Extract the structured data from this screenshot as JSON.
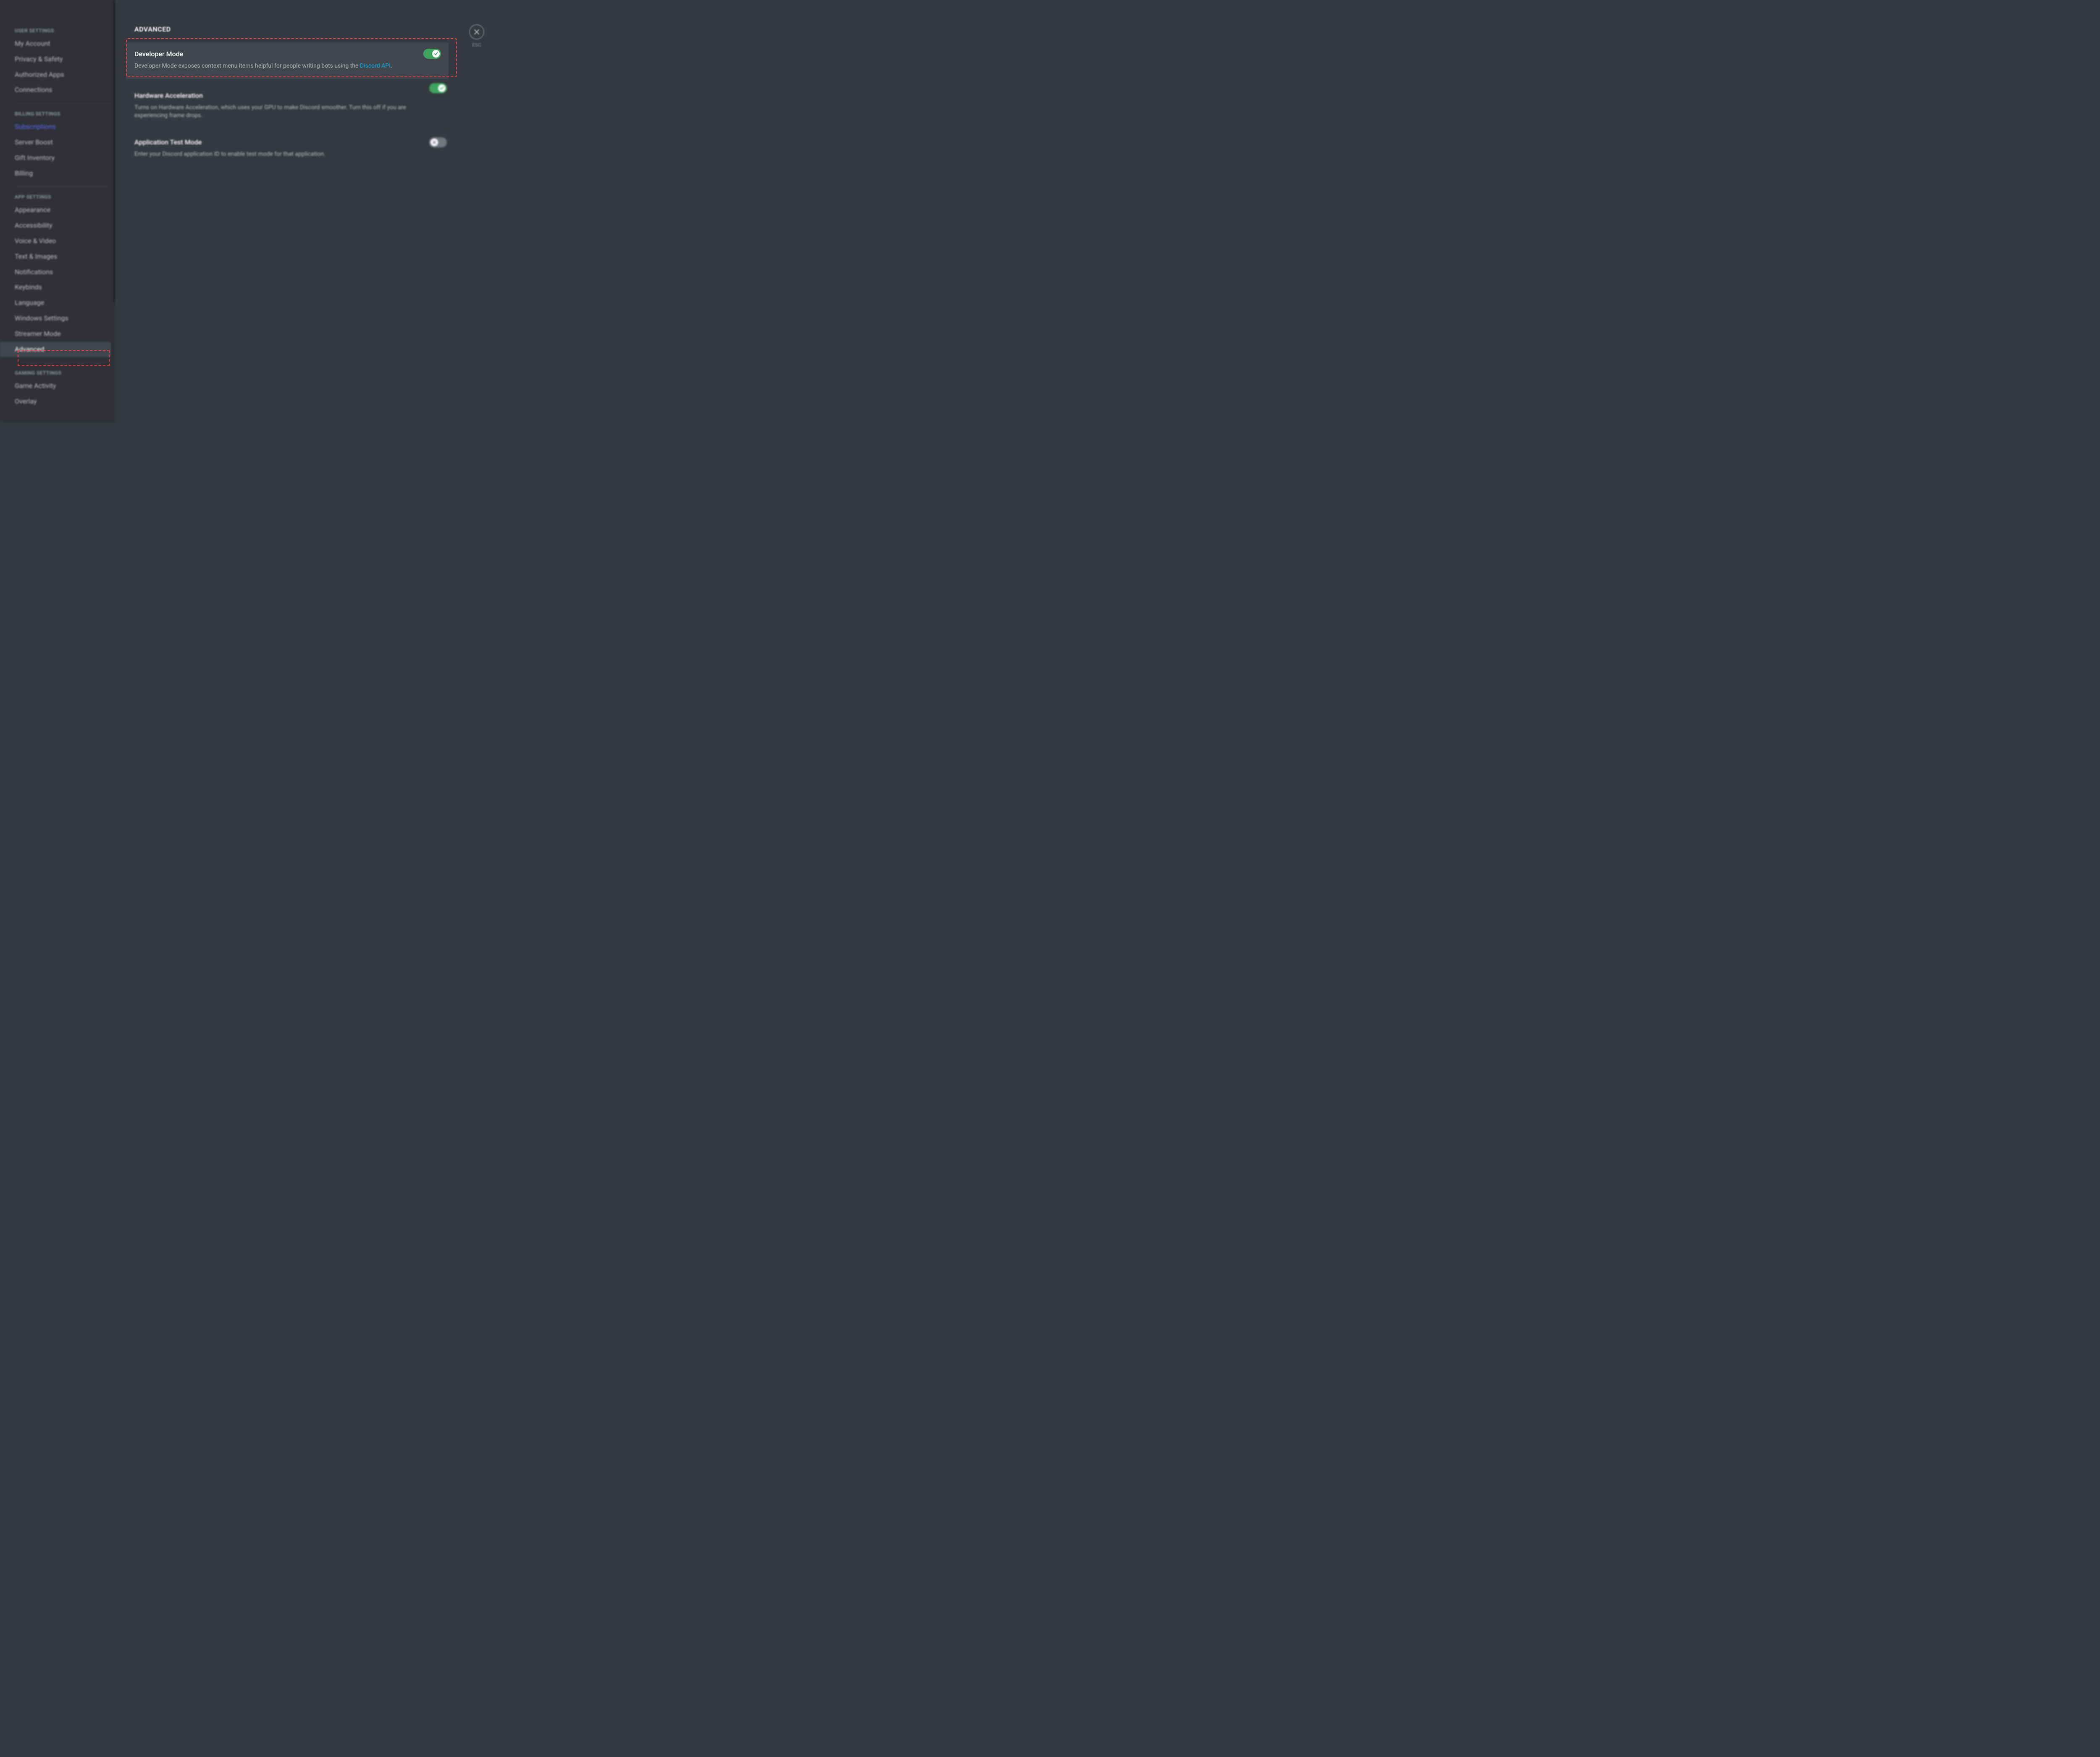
{
  "sidebar": {
    "sections": [
      {
        "header": "USER SETTINGS",
        "items": [
          "My Account",
          "Privacy & Safety",
          "Authorized Apps",
          "Connections"
        ]
      },
      {
        "header": "BILLING SETTINGS",
        "items": [
          "Subscriptions",
          "Server Boost",
          "Gift Inventory",
          "Billing"
        ]
      },
      {
        "header": "APP SETTINGS",
        "items": [
          "Appearance",
          "Accessibility",
          "Voice & Video",
          "Text & Images",
          "Notifications",
          "Keybinds",
          "Language",
          "Windows Settings",
          "Streamer Mode",
          "Advanced"
        ]
      },
      {
        "header": "GAMING SETTINGS",
        "items": [
          "Game Activity",
          "Overlay"
        ]
      }
    ],
    "selected": "Advanced",
    "blueItem": "Subscriptions"
  },
  "page": {
    "title": "ADVANCED",
    "close_label": "ESC"
  },
  "settings": {
    "devmode": {
      "title": "Developer Mode",
      "desc_pre": "Developer Mode exposes context menu items helpful for people writing bots using the ",
      "desc_link": "Discord API",
      "desc_post": ".",
      "state": "on"
    },
    "hardware": {
      "title": "Hardware Acceleration",
      "desc": "Turns on Hardware Acceleration, which uses your GPU to make Discord smoother. Turn this off if you are experiencing frame drops.",
      "state": "on"
    },
    "testmode": {
      "title": "Application Test Mode",
      "desc": "Enter your Discord application ID to enable test mode for that application.",
      "state": "off"
    }
  }
}
